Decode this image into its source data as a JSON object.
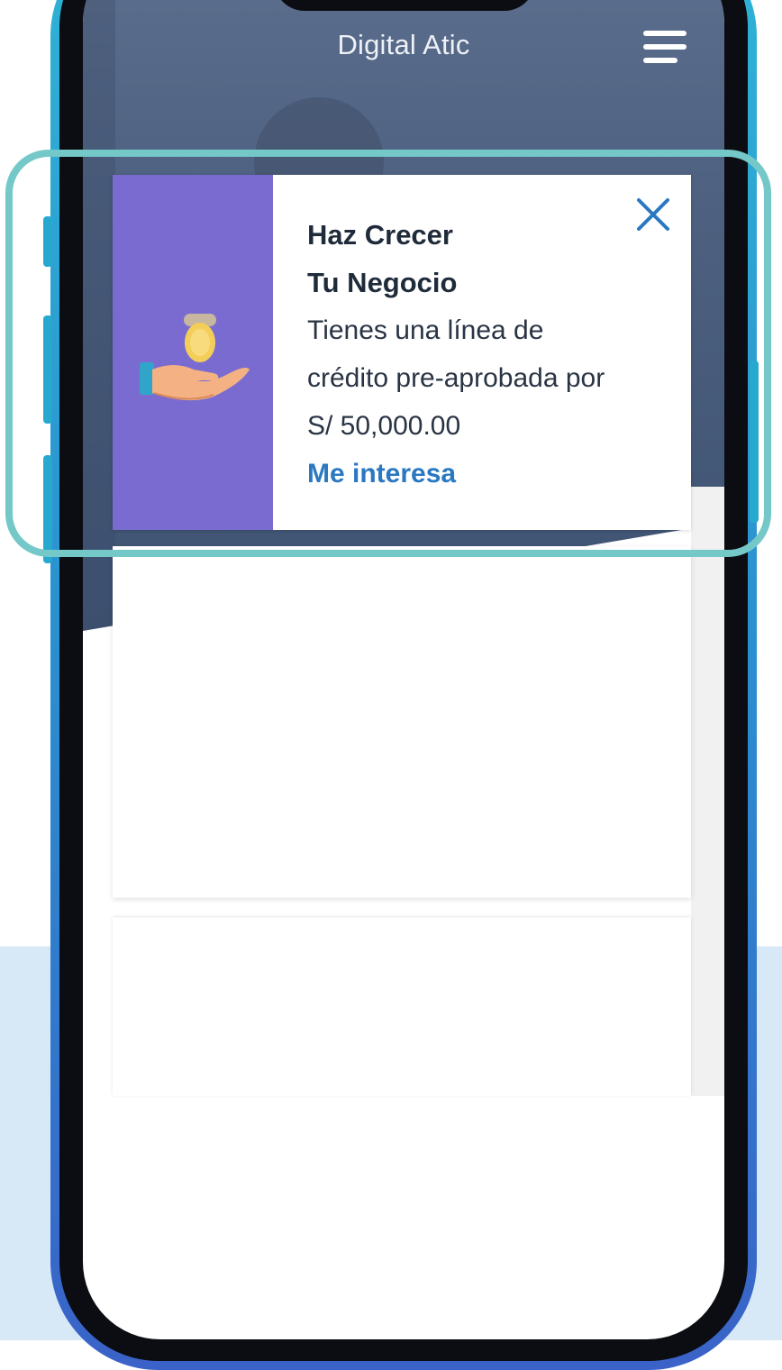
{
  "app": {
    "title": "Digital Atic",
    "menu_icon": "hamburger-menu-icon"
  },
  "promo": {
    "title_line1": "Haz Crecer",
    "title_line2": "Tu Negocio",
    "text_line1": "Tienes una línea de",
    "text_line2": "crédito pre-aprobada por",
    "amount": "S/ 50,000.00",
    "cta": "Me interesa",
    "close_icon": "close-icon",
    "illustration_icon": "hand-holding-coin-icon"
  },
  "colors": {
    "highlight": "#74c8c8",
    "promo_panel": "#7a6bd0",
    "link": "#2a78c2",
    "phone_frame": "#2fb4d6",
    "page_bottom": "#d7e9f7"
  }
}
